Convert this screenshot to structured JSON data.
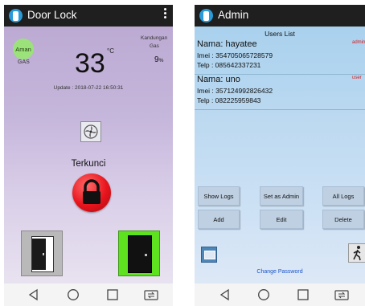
{
  "door_lock": {
    "title": "Door Lock",
    "gas_status_badge": "Aman",
    "gas_caption": "GAS",
    "temperature": "33",
    "temperature_unit": "°C",
    "gas_heading_1": "Kandungan",
    "gas_heading_2": "Gas",
    "gas_value": "9",
    "gas_unit": "%",
    "update_text": "Update : 2018-07-22 16:50:31",
    "lock_status": "Terkunci"
  },
  "admin": {
    "title": "Admin",
    "users_heading": "Users List",
    "users": [
      {
        "name": "Nama: hayatee",
        "imei": "Imei : 354705065728579",
        "telp": "Telp : 085642337231",
        "role_tag": "admin"
      },
      {
        "name": "Nama: uno",
        "imei": "Imei : 357124992826432",
        "telp": "Telp : 082225959843",
        "role_tag": "user"
      }
    ],
    "buttons": {
      "show_logs": "Show Logs",
      "set_as_admin": "Set as Admin",
      "all_logs": "All Logs",
      "add": "Add",
      "edit": "Edit",
      "delete": "Delete"
    },
    "change_password": "Change Password"
  },
  "colors": {
    "app_bar": "#1f1f1f",
    "accent_blue": "#2a9bd8",
    "lock_red": "#e8141c",
    "aman_green": "#9be27a",
    "open_door_green": "#5ee21f",
    "role_tag_red": "#d81b1b",
    "link_blue": "#1a55c8"
  },
  "icons": {
    "nav_back": "back-triangle-icon",
    "nav_home": "home-circle-icon",
    "nav_recents": "recents-square-icon",
    "nav_switch": "switch-app-icon"
  }
}
